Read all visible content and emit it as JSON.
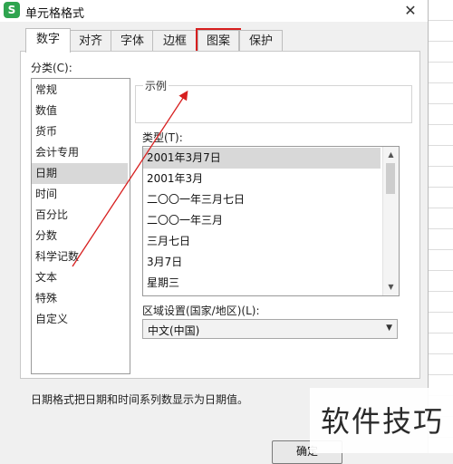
{
  "window": {
    "icon_glyph": "S",
    "title": "单元格格式",
    "close_glyph": "✕"
  },
  "tabs": [
    {
      "label": "数字",
      "active": true
    },
    {
      "label": "对齐"
    },
    {
      "label": "字体"
    },
    {
      "label": "边框"
    },
    {
      "label": "图案",
      "highlighted": true
    },
    {
      "label": "保护"
    }
  ],
  "category": {
    "label": "分类(C):",
    "items": [
      "常规",
      "数值",
      "货币",
      "会计专用",
      "日期",
      "时间",
      "百分比",
      "分数",
      "科学记数",
      "文本",
      "特殊",
      "自定义"
    ],
    "selected": "日期"
  },
  "sample": {
    "label": "示例",
    "value": ""
  },
  "type": {
    "label": "类型(T):",
    "items": [
      "2001年3月7日",
      "2001年3月",
      "二〇〇一年三月七日",
      "二〇〇一年三月",
      "三月七日",
      "3月7日",
      "星期三"
    ],
    "selected": "2001年3月7日"
  },
  "region": {
    "label": "区域设置(国家/地区)(L):",
    "value": "中文(中国)"
  },
  "description": "日期格式把日期和时间系列数显示为日期值。",
  "buttons": {
    "ok": "确定"
  },
  "watermark": "软件技巧",
  "colors": {
    "annotation_red": "#d71f1f",
    "selection": "#d8d8d8",
    "app_icon_green": "#2fa44f"
  }
}
